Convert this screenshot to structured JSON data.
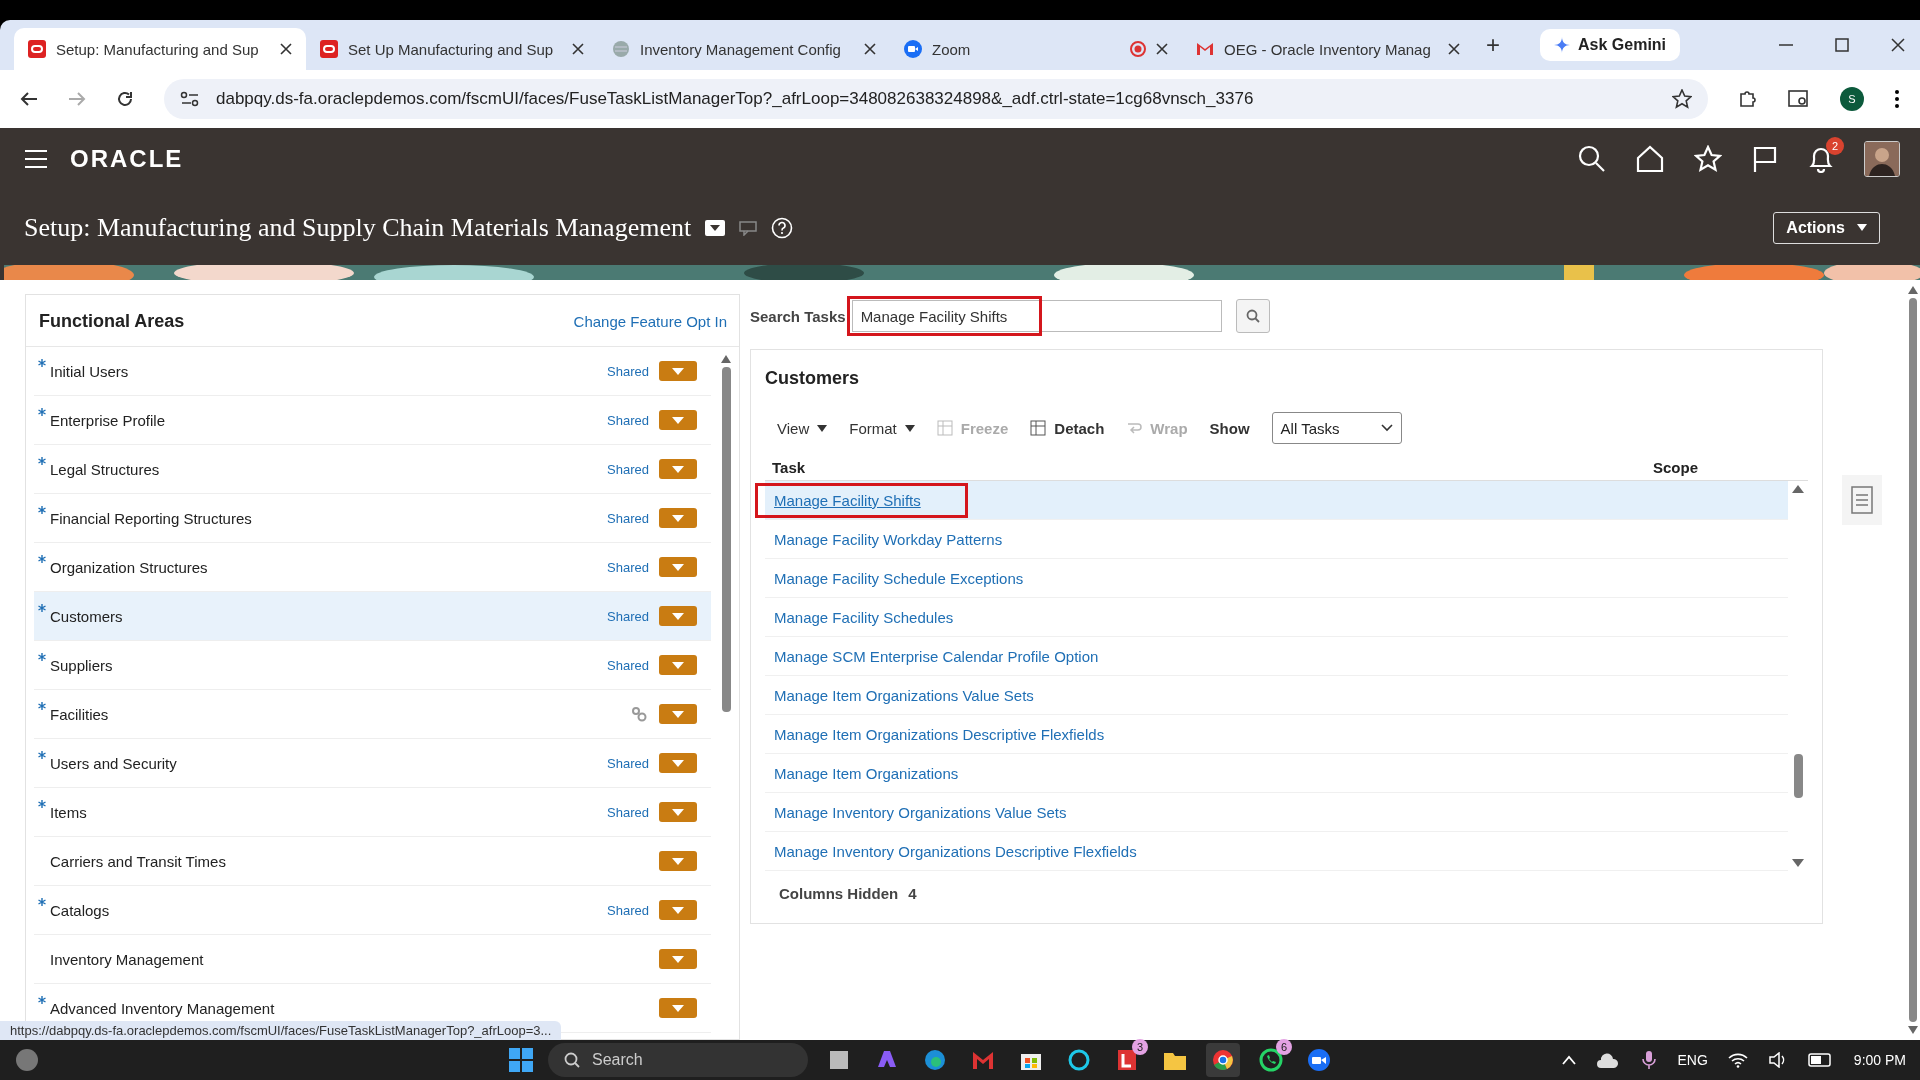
{
  "browser": {
    "tabs": [
      {
        "title": "Setup: Manufacturing and Sup",
        "kind": "oracle",
        "selected": true
      },
      {
        "title": "Set Up Manufacturing and Sup",
        "kind": "oracle",
        "selected": false
      },
      {
        "title": "Inventory Management Config",
        "kind": "globe",
        "selected": false
      },
      {
        "title": "Zoom",
        "kind": "zoom",
        "recording": true,
        "selected": false
      },
      {
        "title": "OEG - Oracle Inventory Manag",
        "kind": "mail",
        "selected": false
      }
    ],
    "new_tab": "+",
    "ask_gemini": "Ask Gemini",
    "url": "dabpqy.ds-fa.oraclepdemos.com/fscmUI/faces/FuseTaskListManagerTop?_afrLoop=348082638324898&_adf.ctrl-state=1cg68vnsch_3376",
    "profile_initial": "S"
  },
  "header": {
    "logo": "ORACLE",
    "notification_count": "2",
    "page_title": "Setup: Manufacturing and Supply Chain Materials Management",
    "actions_button": "Actions"
  },
  "functional_areas": {
    "title": "Functional Areas",
    "link": "Change Feature Opt In",
    "items": [
      {
        "name": "Initial Users",
        "required": true,
        "scope": "Shared",
        "selected": false
      },
      {
        "name": "Enterprise Profile",
        "required": true,
        "scope": "Shared",
        "selected": false
      },
      {
        "name": "Legal Structures",
        "required": true,
        "scope": "Shared",
        "selected": false
      },
      {
        "name": "Financial Reporting Structures",
        "required": true,
        "scope": "Shared",
        "selected": false
      },
      {
        "name": "Organization Structures",
        "required": true,
        "scope": "Shared",
        "selected": false
      },
      {
        "name": "Customers",
        "required": true,
        "scope": "Shared",
        "selected": true
      },
      {
        "name": "Suppliers",
        "required": true,
        "scope": "Shared",
        "selected": false
      },
      {
        "name": "Facilities",
        "required": true,
        "setup_icon": true,
        "selected": false
      },
      {
        "name": "Users and Security",
        "required": true,
        "scope": "Shared",
        "selected": false
      },
      {
        "name": "Items",
        "required": true,
        "scope": "Shared",
        "selected": false
      },
      {
        "name": "Carriers and Transit Times",
        "required": false,
        "selected": false
      },
      {
        "name": "Catalogs",
        "required": true,
        "scope": "Shared",
        "selected": false
      },
      {
        "name": "Inventory Management",
        "required": false,
        "selected": false
      },
      {
        "name": "Advanced Inventory Management",
        "required": true,
        "selected": false
      }
    ]
  },
  "search_tasks": {
    "label": "Search Tasks",
    "value": "Manage Facility Shifts",
    "highlighted": true
  },
  "tasks_panel": {
    "title": "Customers",
    "toolbar": [
      {
        "kind": "menu",
        "label": "View",
        "disabled": false
      },
      {
        "kind": "menu",
        "label": "Format",
        "disabled": false
      },
      {
        "kind": "grid",
        "label": "Freeze",
        "disabled": true
      },
      {
        "kind": "grid",
        "label": "Detach",
        "disabled": false
      },
      {
        "kind": "wrap",
        "label": "Wrap",
        "disabled": true
      },
      {
        "kind": "select",
        "label": "Show",
        "value": "All Tasks",
        "disabled": false
      }
    ],
    "columns": [
      "Task",
      "Scope"
    ],
    "rows": [
      {
        "task": "Manage Facility Shifts",
        "selected": true,
        "highlighted": true
      },
      {
        "task": "Manage Facility Workday Patterns",
        "selected": false,
        "highlighted": false
      },
      {
        "task": "Manage Facility Schedule Exceptions",
        "selected": false,
        "highlighted": false
      },
      {
        "task": "Manage Facility Schedules",
        "selected": false,
        "highlighted": false
      },
      {
        "task": "Manage SCM Enterprise Calendar Profile Option",
        "selected": false,
        "highlighted": false
      },
      {
        "task": "Manage Item Organizations Value Sets",
        "selected": false,
        "highlighted": false
      },
      {
        "task": "Manage Item Organizations Descriptive Flexfields",
        "selected": false,
        "highlighted": false
      },
      {
        "task": "Manage Item Organizations",
        "selected": false,
        "highlighted": false
      },
      {
        "task": "Manage Inventory Organizations Value Sets",
        "selected": false,
        "highlighted": false
      },
      {
        "task": "Manage Inventory Organizations Descriptive Flexfields",
        "selected": false,
        "highlighted": false
      }
    ],
    "columns_hidden_label": "Columns Hidden",
    "columns_hidden_count": "4"
  },
  "status_url": "https://dabpqy.ds-fa.oraclepdemos.com/fscmUI/faces/FuseTaskListManagerTop?_afrLoop=3...",
  "taskbar": {
    "search": "Search",
    "apps": [
      {
        "kind": "files",
        "active": false
      },
      {
        "kind": "copilot",
        "active": false
      },
      {
        "kind": "edge",
        "active": false
      },
      {
        "kind": "mail",
        "active": false
      },
      {
        "kind": "store",
        "active": false
      },
      {
        "kind": "ring",
        "active": false
      },
      {
        "kind": "office",
        "badge": "3",
        "active": false
      },
      {
        "kind": "folder",
        "active": false
      },
      {
        "kind": "chrome",
        "active": true
      },
      {
        "kind": "phone",
        "badge": "6",
        "active": false
      },
      {
        "kind": "zoom",
        "active": false
      }
    ],
    "language": "ENG",
    "time": "9:00 PM"
  }
}
